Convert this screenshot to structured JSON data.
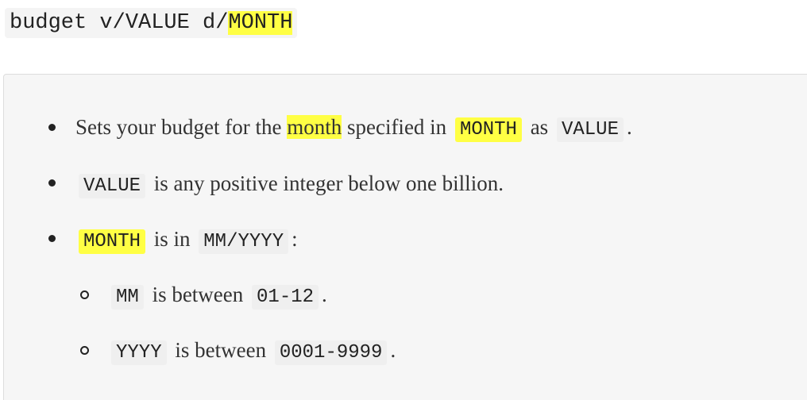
{
  "command": {
    "prefix": "budget v/VALUE d/",
    "highlight": "MONTH"
  },
  "items": [
    {
      "seg1": "Sets your budget for the",
      "hl_word": "month",
      "seg2": "specified in",
      "code1": "MONTH",
      "seg3": "as",
      "code2": "VALUE",
      "seg4": "."
    },
    {
      "code1": "VALUE",
      "seg1": "is any positive integer below one billion."
    },
    {
      "code1": "MONTH",
      "seg1": "is in",
      "code2": "MM/YYYY",
      "seg2": ":"
    }
  ],
  "subitems": [
    {
      "code1": "MM",
      "seg1": "is between",
      "code2": "01-12",
      "seg2": "."
    },
    {
      "code1": "YYYY",
      "seg1": "is between",
      "code2": "0001-9999",
      "seg2": "."
    }
  ],
  "colors": {
    "highlight": "#ffff44",
    "panel_bg": "#f6f6f6",
    "code_bg": "#efefef",
    "text": "#333333"
  }
}
